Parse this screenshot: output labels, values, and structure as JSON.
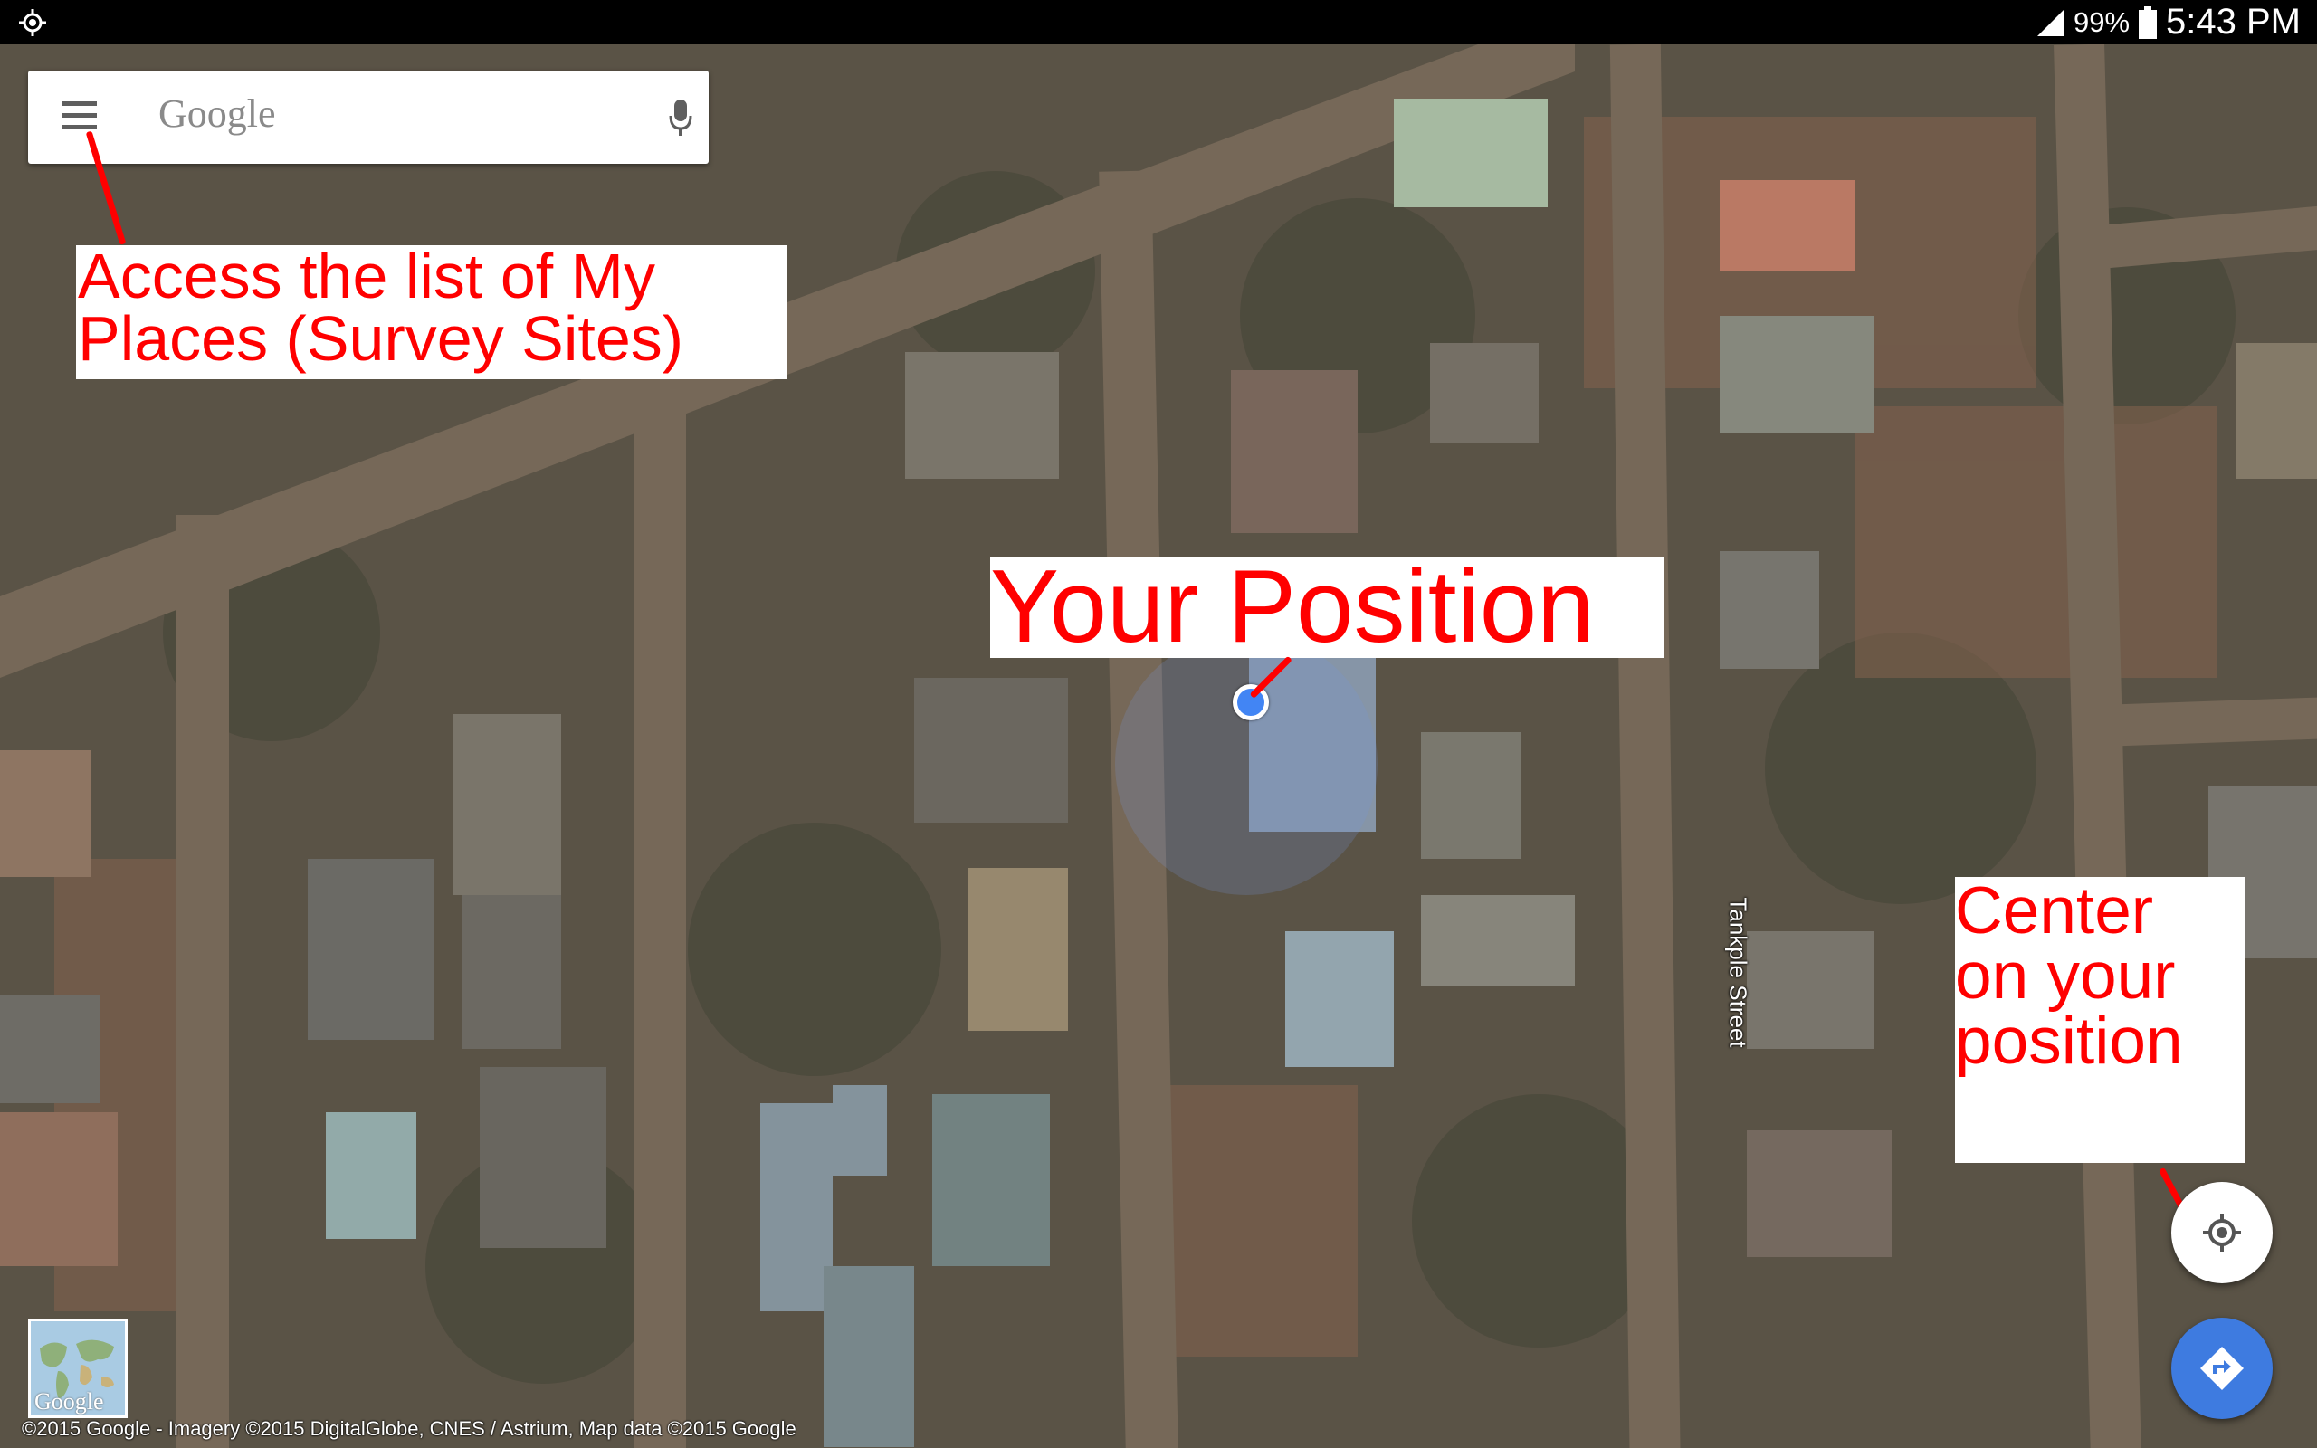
{
  "status_bar": {
    "gps_icon": "location-icon",
    "signal_icon": "signal-icon",
    "battery_percent": "99%",
    "battery_icon": "battery-icon",
    "time": "5:43 PM"
  },
  "search": {
    "menu_icon": "menu-icon",
    "logo_text": "Google",
    "mic_icon": "microphone-icon"
  },
  "annotations": {
    "menu_callout_line1": "Access the list of My",
    "menu_callout_line2": "Places (Survey Sites)",
    "position_callout": "Your Position",
    "center_callout_line1": "Center",
    "center_callout_line2": "on your",
    "center_callout_line3": "position"
  },
  "map": {
    "street_label": "Tankple Street",
    "thumbnail_label": "Google",
    "attribution": "©2015 Google - Imagery ©2015 DigitalGlobe, CNES / Astrium, Map data ©2015 Google"
  },
  "buttons": {
    "center_icon": "my-location-icon",
    "directions_icon": "directions-icon"
  },
  "colors": {
    "annotation_text": "#ff0000",
    "directions_button": "#3e7be0",
    "location_dot": "#4285f4"
  }
}
